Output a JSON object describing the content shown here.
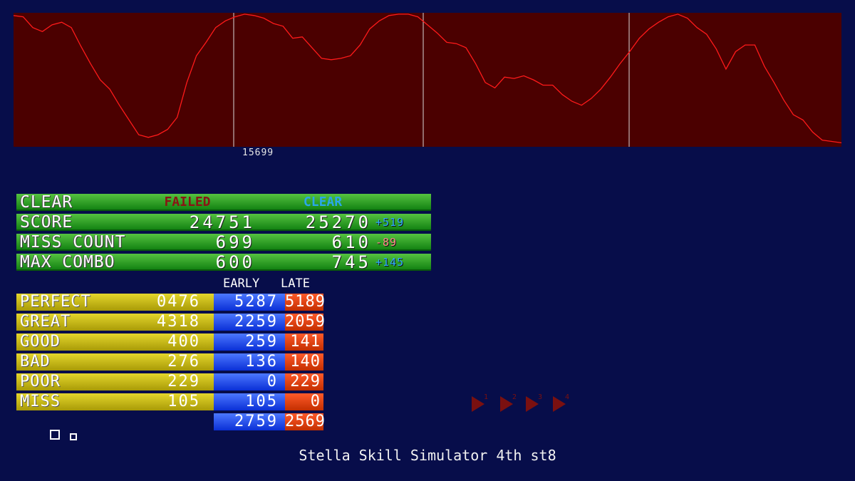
{
  "graph": {
    "marker_value": "15699",
    "colors": {
      "background": "#4b0000",
      "line": "#ff1a1a",
      "divider": "#d8d8d8"
    },
    "gauge_curve": [
      98,
      97,
      89,
      86,
      91,
      93,
      89,
      75,
      62,
      50,
      43,
      31,
      20,
      9,
      7,
      9,
      13,
      22,
      48,
      68,
      78,
      89,
      94,
      97,
      99,
      98,
      96,
      92,
      90,
      81,
      82,
      74,
      66,
      65,
      66,
      68,
      76,
      88,
      94,
      98,
      99,
      99,
      97,
      91,
      85,
      78,
      77,
      74,
      62,
      48,
      44,
      52,
      51,
      53,
      50,
      46,
      46,
      39,
      34,
      31,
      36,
      43,
      52,
      62,
      71,
      81,
      88,
      93,
      97,
      99,
      96,
      89,
      84,
      73,
      58,
      71,
      76,
      76,
      60,
      48,
      35,
      24,
      20,
      11,
      5,
      4,
      3
    ]
  },
  "summary": {
    "rows": [
      {
        "label": "CLEAR",
        "status1": "FAILED",
        "status2": "CLEAR"
      },
      {
        "label": "SCORE",
        "v1": "24751",
        "v2": "25270",
        "delta": "+519",
        "delta_color": "#2fa9ff"
      },
      {
        "label": "MISS COUNT",
        "v1": "699",
        "v2": "610",
        "delta": "-89",
        "delta_color": "#ff8a8a"
      },
      {
        "label": "MAX COMBO",
        "v1": "600",
        "v2": "745",
        "delta": "+145",
        "delta_color": "#2fa9ff"
      }
    ]
  },
  "judge": {
    "header": {
      "early": "EARLY",
      "late": "LATE"
    },
    "rows": [
      {
        "name": "PERFECT",
        "total": "0476",
        "early": "5287",
        "late": "5189"
      },
      {
        "name": "GREAT",
        "total": "4318",
        "early": "2259",
        "late": "2059"
      },
      {
        "name": "GOOD",
        "total": "400",
        "early": "259",
        "late": "141"
      },
      {
        "name": "BAD",
        "total": "276",
        "early": "136",
        "late": "140"
      },
      {
        "name": "POOR",
        "total": "229",
        "early": "0",
        "late": "229"
      },
      {
        "name": "MISS",
        "total": "105",
        "early": "105",
        "late": "0"
      }
    ],
    "totals": {
      "early": "2759",
      "late": "2569"
    }
  },
  "controls": {
    "arrows": [
      "1",
      "2",
      "3",
      "4"
    ],
    "icon": "play-arrow-icon",
    "color": "#7a1010"
  },
  "footer": {
    "text": "Stella Skill Simulator 4th st8"
  }
}
